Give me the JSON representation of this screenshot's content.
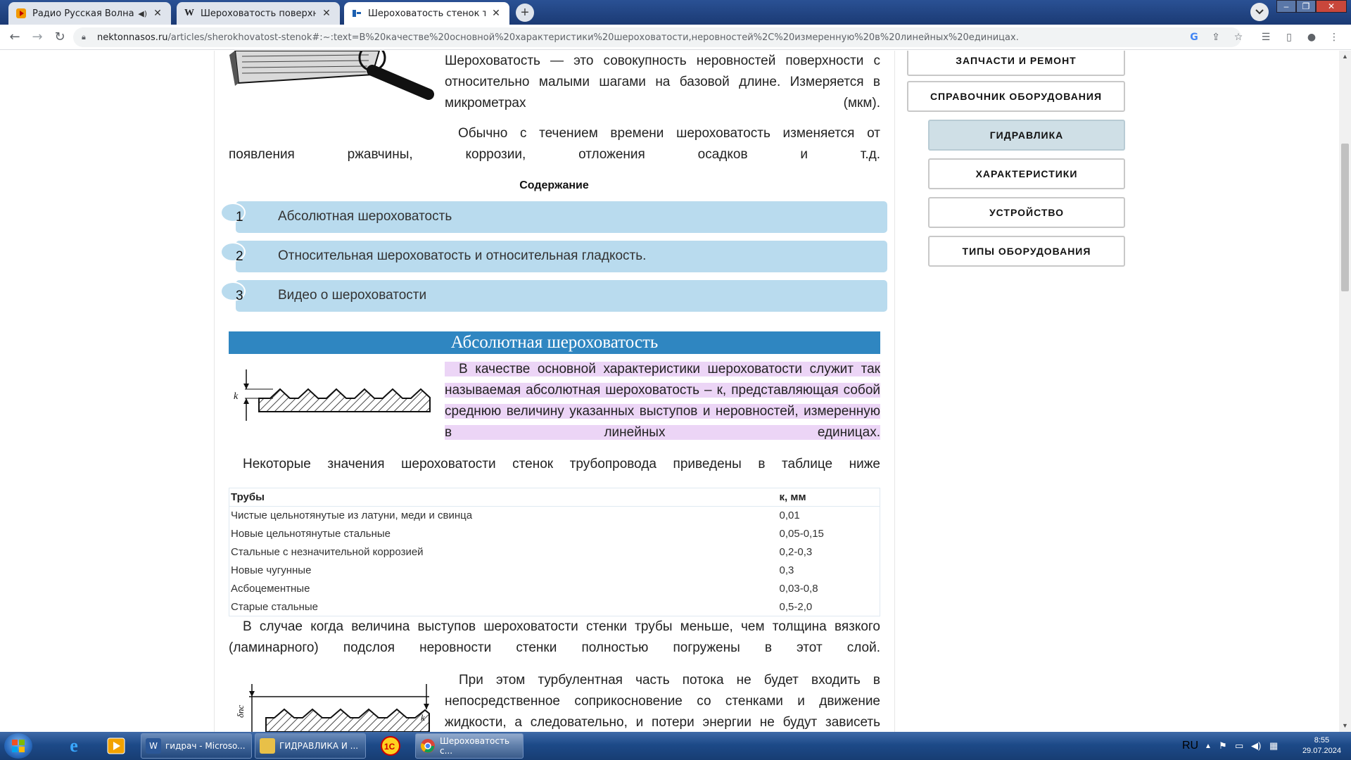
{
  "browser": {
    "tabs": [
      {
        "title": "Радио Русская Волна – слуш",
        "favicon": "play-icon",
        "muted": true
      },
      {
        "title": "Шероховатость поверхности —",
        "favicon": "wikipedia-icon"
      },
      {
        "title": "Шероховатость стенок трубопр",
        "favicon": "site-icon"
      }
    ],
    "url_host": "nektonnasos.ru",
    "url_rest": "/articles/sherokhovatost-stenok#:~:text=В%20качестве%20основной%20характеристики%20шероховатости,неровностей%2C%20измеренную%20в%20линейных%20единицах."
  },
  "page": {
    "intro_para1": "Шероховатость — это совокупность неровностей поверхности с относительно малыми шагами на базовой длине. Измеряется в микрометрах (мкм).",
    "intro_para2": "Обычно с течением времени шероховатость изменяется от появления ржавчины, коррозии, отложения осадков и т.д.",
    "toc_title": "Содержание",
    "toc": [
      {
        "num": "1",
        "label": "Абсолютная шероховатость"
      },
      {
        "num": "2",
        "label": "Относительная шероховатость и относительная гладкость."
      },
      {
        "num": "3",
        "label": "Видео о шероховатости"
      }
    ],
    "section_heading": "Абсолютная шероховатость",
    "highlight_para": "В качестве основной характеристики шероховатости служит так называемая абсолютная шероховатость – к, представляющая собой среднюю величину указанных выступов и неровностей, измеренную в линейных единицах.",
    "fig1_label": "k",
    "table_intro": "Некоторые значения шероховатости стенок трубопровода приведены в таблице ниже",
    "table": {
      "headers": [
        "Трубы",
        "к, мм"
      ],
      "rows": [
        [
          "Чистые цельнотянутые из латуни, меди и свинца",
          "0,01"
        ],
        [
          "Новые цельнотянутые стальные",
          "0,05-0,15"
        ],
        [
          "Стальные с незначительной коррозией",
          "0,2-0,3"
        ],
        [
          "Новые чугунные",
          "0,3"
        ],
        [
          "Асбоцементные",
          "0,03-0,8"
        ],
        [
          "Старые стальные",
          "0,5-2,0"
        ]
      ]
    },
    "laminar_para": "В случае когда величина выступов шероховатости стенки трубы меньше, чем толщина вязкого (ламинарного) подслоя неровности стенки полностью погружены в этот слой.",
    "turbulent_para": "При этом турбулентная часть потока не будет входить в непосредственное соприкосновение со стенками и движение жидкости, а следовательно, и потери энергии не будут зависеть",
    "fig2_label_d": "δпс",
    "fig2_label_k": "k"
  },
  "sidebar": {
    "items": [
      {
        "label": "ЗАПЧАСТИ И РЕМОНТ"
      },
      {
        "label": "СПРАВОЧНИК ОБОРУДОВАНИЯ"
      },
      {
        "label": "ГИДРАВЛИКА"
      },
      {
        "label": "ХАРАКТЕРИСТИКИ"
      },
      {
        "label": "УСТРОЙСТВО"
      },
      {
        "label": "ТИПЫ ОБОРУДОВАНИЯ"
      }
    ]
  },
  "taskbar": {
    "windows": [
      {
        "title": "гидрач - Microso...",
        "icon": "word-icon"
      },
      {
        "title": "ГИДРАВЛИКА И ...",
        "icon": "folder-icon"
      },
      {
        "title": "Шероховатость с...",
        "icon": "chrome-icon"
      }
    ],
    "lang": "RU",
    "time": "8:55",
    "date": "29.07.2024"
  }
}
